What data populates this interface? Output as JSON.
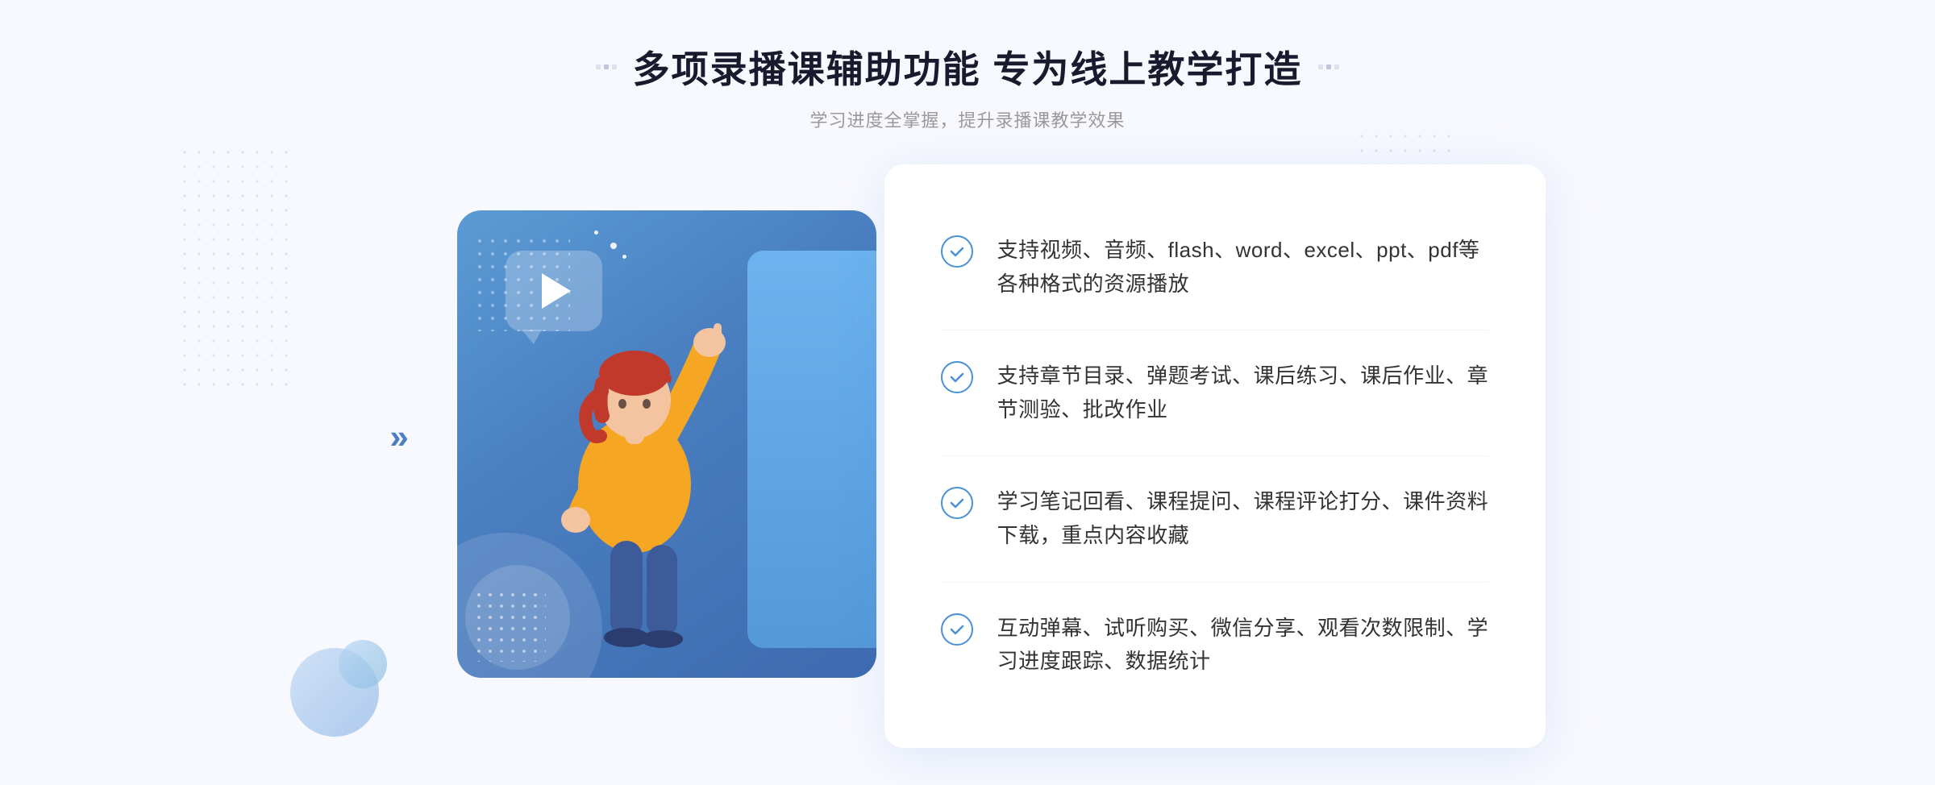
{
  "page": {
    "background": "#f8f9ff"
  },
  "header": {
    "title": "多项录播课辅助功能 专为线上教学打造",
    "subtitle": "学习进度全掌握，提升录播课教学效果"
  },
  "features": [
    {
      "id": 1,
      "text": "支持视频、音频、flash、word、excel、ppt、pdf等各种格式的资源播放"
    },
    {
      "id": 2,
      "text": "支持章节目录、弹题考试、课后练习、课后作业、章节测验、批改作业"
    },
    {
      "id": 3,
      "text": "学习笔记回看、课程提问、课程评论打分、课件资料下载，重点内容收藏"
    },
    {
      "id": 4,
      "text": "互动弹幕、试听购买、微信分享、观看次数限制、学习进度跟踪、数据统计"
    }
  ],
  "icons": {
    "check": "✓",
    "chevron_left": "«",
    "chevron_right": "»",
    "play": "▶"
  }
}
